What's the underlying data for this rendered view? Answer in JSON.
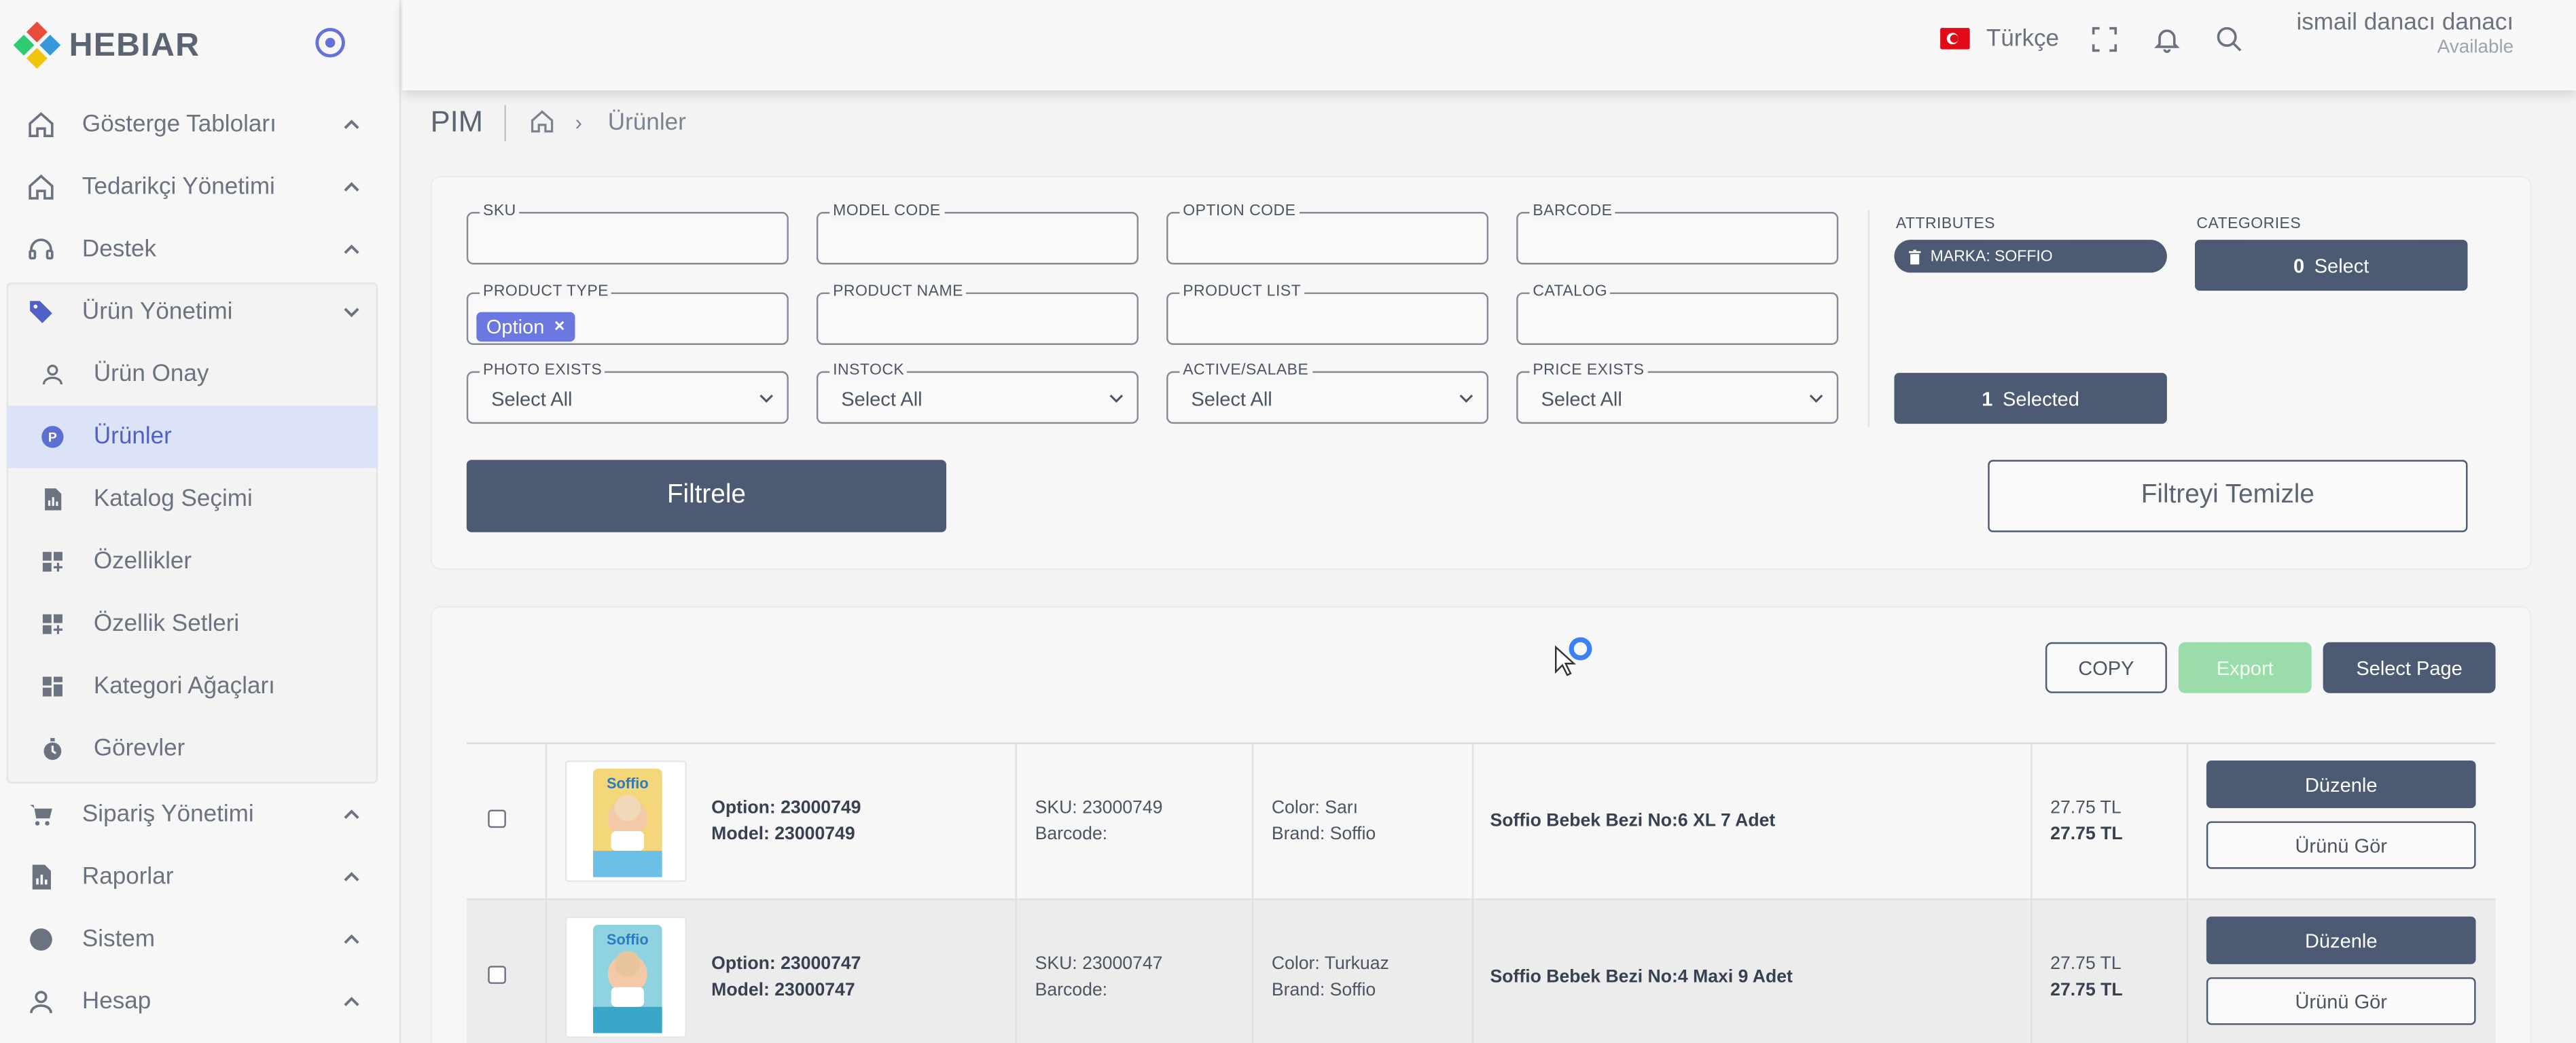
{
  "brand": {
    "name": "HEBIAR"
  },
  "sidebar": {
    "items": [
      {
        "label": "Gösterge Tabloları",
        "icon": "home-icon"
      },
      {
        "label": "Tedarikçi Yönetimi",
        "icon": "home-icon"
      },
      {
        "label": "Destek",
        "icon": "headset-icon"
      },
      {
        "label": "Ürün Yönetimi",
        "icon": "tag-icon",
        "expanded": true
      },
      {
        "label": "Sipariş Yönetimi",
        "icon": "cart-icon"
      },
      {
        "label": "Raporlar",
        "icon": "report-icon"
      },
      {
        "label": "Sistem",
        "icon": "circle-icon"
      },
      {
        "label": "Hesap",
        "icon": "user-icon"
      }
    ],
    "subitems": [
      {
        "label": "Ürün Onay",
        "icon": "user-icon"
      },
      {
        "label": "Ürünler",
        "icon": "p-badge-icon",
        "active": true
      },
      {
        "label": "Katalog Seçimi",
        "icon": "document-chart-icon"
      },
      {
        "label": "Özellikler",
        "icon": "grid-plus-icon"
      },
      {
        "label": "Özellik Setleri",
        "icon": "grid-plus-icon"
      },
      {
        "label": "Kategori Ağaçları",
        "icon": "grid-icon"
      },
      {
        "label": "Görevler",
        "icon": "stopwatch-icon"
      }
    ]
  },
  "topbar": {
    "language": "Türkçe",
    "user_name": "ismail danacı danacı",
    "user_status": "Available"
  },
  "breadcrumb": {
    "section": "PIM",
    "page": "Ürünler",
    "separator": "›"
  },
  "filters": {
    "sku": {
      "label": "SKU",
      "value": ""
    },
    "model_code": {
      "label": "MODEL CODE",
      "value": ""
    },
    "option_code": {
      "label": "OPTION CODE",
      "value": ""
    },
    "barcode": {
      "label": "BARCODE",
      "value": ""
    },
    "product_type": {
      "label": "PRODUCT TYPE",
      "chip": "Option",
      "chip_remove": "×"
    },
    "product_name": {
      "label": "PRODUCT NAME",
      "value": ""
    },
    "product_list": {
      "label": "PRODUCT LIST",
      "value": ""
    },
    "catalog": {
      "label": "CATALOG",
      "value": ""
    },
    "photo_exists": {
      "label": "PHOTO EXISTS",
      "value": "Select All"
    },
    "instock": {
      "label": "INSTOCK",
      "value": "Select All"
    },
    "active_salable": {
      "label": "ACTIVE/SALABE",
      "value": "Select All"
    },
    "price_exists": {
      "label": "PRICE EXISTS",
      "value": "Select All"
    },
    "attributes": {
      "label": "ATTRIBUTES",
      "pill": "MARKA: SOFFIO"
    },
    "categories": {
      "label": "CATEGORIES",
      "count": "0",
      "text": "Select"
    },
    "selected": {
      "count": "1",
      "text": "Selected"
    },
    "filter_button": "Filtrele",
    "clear_button": "Filtreyi Temizle"
  },
  "actions": {
    "copy": "COPY",
    "export": "Export",
    "select_page": "Select Page"
  },
  "products": [
    {
      "option": "Option: 23000749",
      "model": "Model: 23000749",
      "sku": "SKU: 23000749",
      "barcode": "Barcode:",
      "color": "Color: Sarı",
      "brand": "Brand: Soffio",
      "name": "Soffio Bebek Bezi No:6 XL 7 Adet",
      "price": "27.75 TL",
      "sale_price": "27.75 TL",
      "edit": "Düzenle",
      "view": "Ürünü Gör",
      "thumb_label": "Soffio"
    },
    {
      "option": "Option: 23000747",
      "model": "Model: 23000747",
      "sku": "SKU: 23000747",
      "barcode": "Barcode:",
      "color": "Color: Turkuaz",
      "brand": "Brand: Soffio",
      "name": "Soffio Bebek Bezi No:4 Maxi 9 Adet",
      "price": "27.75 TL",
      "sale_price": "27.75 TL",
      "edit": "Düzenle",
      "view": "Ürünü Gör",
      "thumb_label": "Soffio"
    }
  ],
  "colors": {
    "primary": "#4c5a74",
    "accent": "#6272d6",
    "export": "#9bdcab",
    "active_bg": "#dde3f7"
  }
}
